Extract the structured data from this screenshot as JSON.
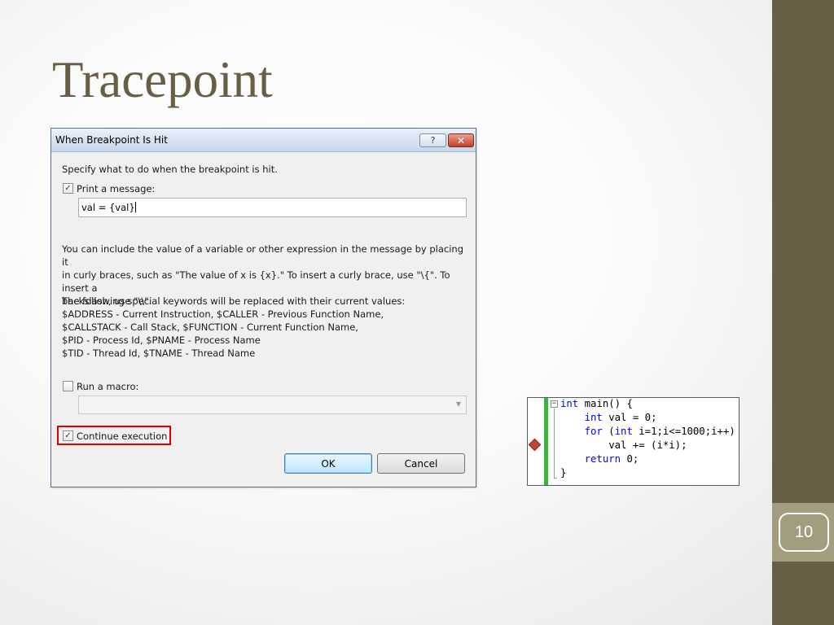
{
  "slide": {
    "title": "Tracepoint",
    "page_number": "10"
  },
  "dialog": {
    "title": "When Breakpoint Is Hit",
    "help_label": "?",
    "close_label": "✕",
    "intro": "Specify what to do when the breakpoint is hit.",
    "print_message": {
      "label": "Print a message:",
      "checked": true,
      "value": "val = {val}"
    },
    "help_text_lines": [
      "You can include the value of a variable or other expression in the message by placing it",
      "in curly braces, such as \"The value of x is {x}.\" To insert a curly brace, use \"\\{\". To insert a",
      "backslash, use \"\\\\\"."
    ],
    "keywords_lines": [
      "The following special keywords will be replaced with their current values:",
      "$ADDRESS - Current Instruction, $CALLER - Previous Function Name,",
      "$CALLSTACK - Call Stack, $FUNCTION - Current Function Name,",
      "$PID - Process Id, $PNAME - Process Name",
      "$TID - Thread Id, $TNAME - Thread Name"
    ],
    "run_macro": {
      "label": "Run a macro:",
      "checked": false,
      "value": ""
    },
    "continue_execution": {
      "label": "Continue execution",
      "checked": true
    },
    "ok_label": "OK",
    "cancel_label": "Cancel",
    "check_glyph": "✓"
  },
  "code_panel": {
    "collapse_glyph": "−",
    "lines": [
      {
        "kw": "int",
        "rest": " main() {"
      },
      {
        "indent": "    ",
        "kw": "int",
        "rest": " val = 0;"
      },
      {
        "indent": "    ",
        "kw": "for",
        "rest": " (",
        "kw2": "int",
        "rest2": " i=1;i<=1000;i++)"
      },
      {
        "indent": "        ",
        "rest": "val += (i*i);"
      },
      {
        "indent": "    ",
        "kw": "return",
        "rest": " 0;"
      },
      {
        "rest": "}"
      }
    ],
    "colors": {
      "keyword": "#0000ff",
      "bar": "#35b53a",
      "breakpoint": "#c2413a"
    }
  },
  "colors": {
    "title": "#675e45",
    "sidebar": "#675e45",
    "page_tab": "#a39d80"
  }
}
